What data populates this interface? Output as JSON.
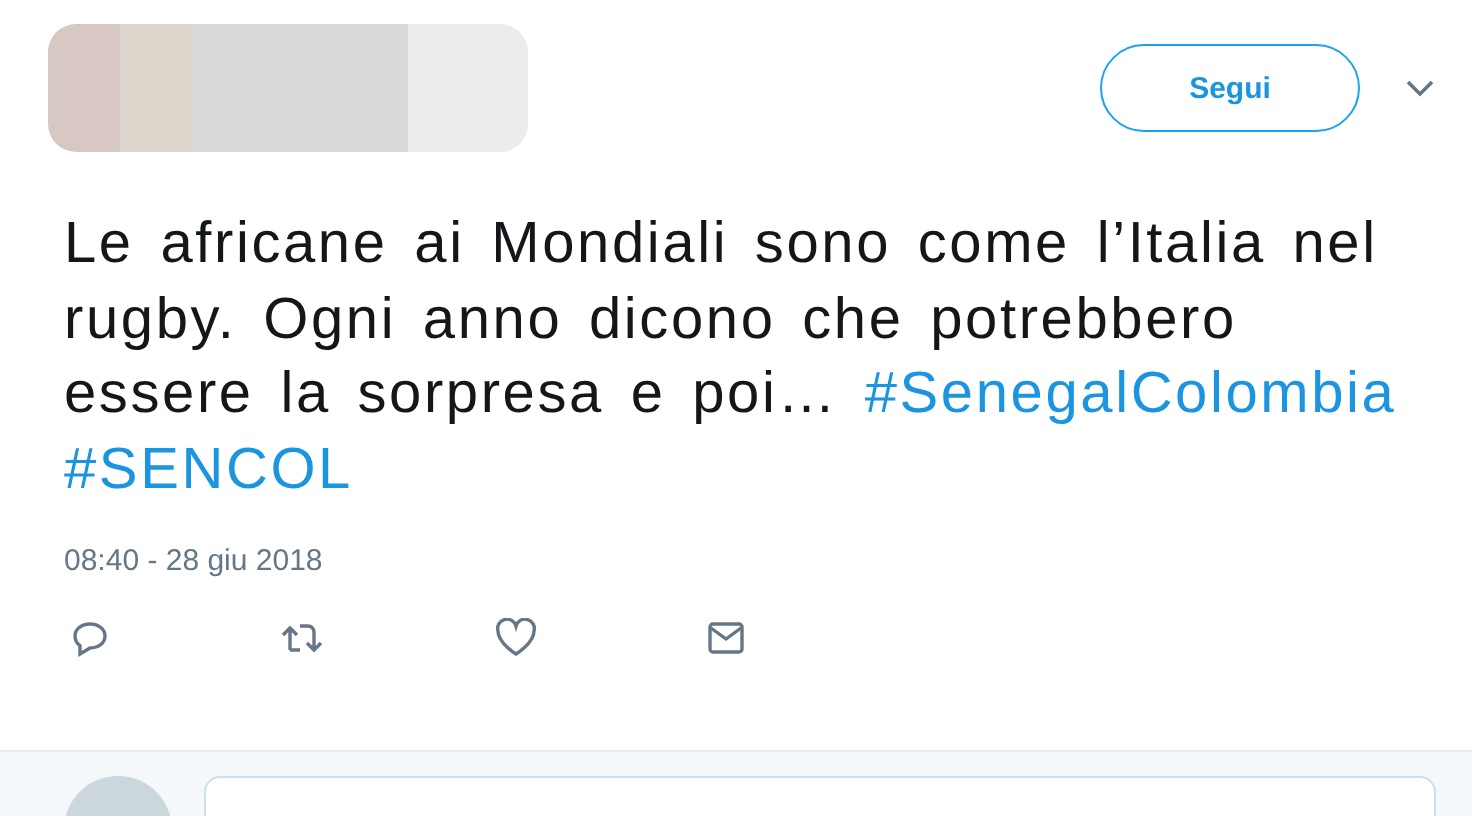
{
  "header": {
    "follow_button": "Segui"
  },
  "tweet": {
    "segments": [
      {
        "kind": "plain",
        "text": "Le africane ai Mondiali sono come l’Italia nel rugby. Ogni anno dicono che potrebbero essere la sorpresa e poi… "
      },
      {
        "kind": "hashtag",
        "text": "#SenegalColombia"
      },
      {
        "kind": "hashtag",
        "text": "#SENCOL"
      }
    ]
  },
  "timestamp": "08:40 - 28 giu 2018"
}
